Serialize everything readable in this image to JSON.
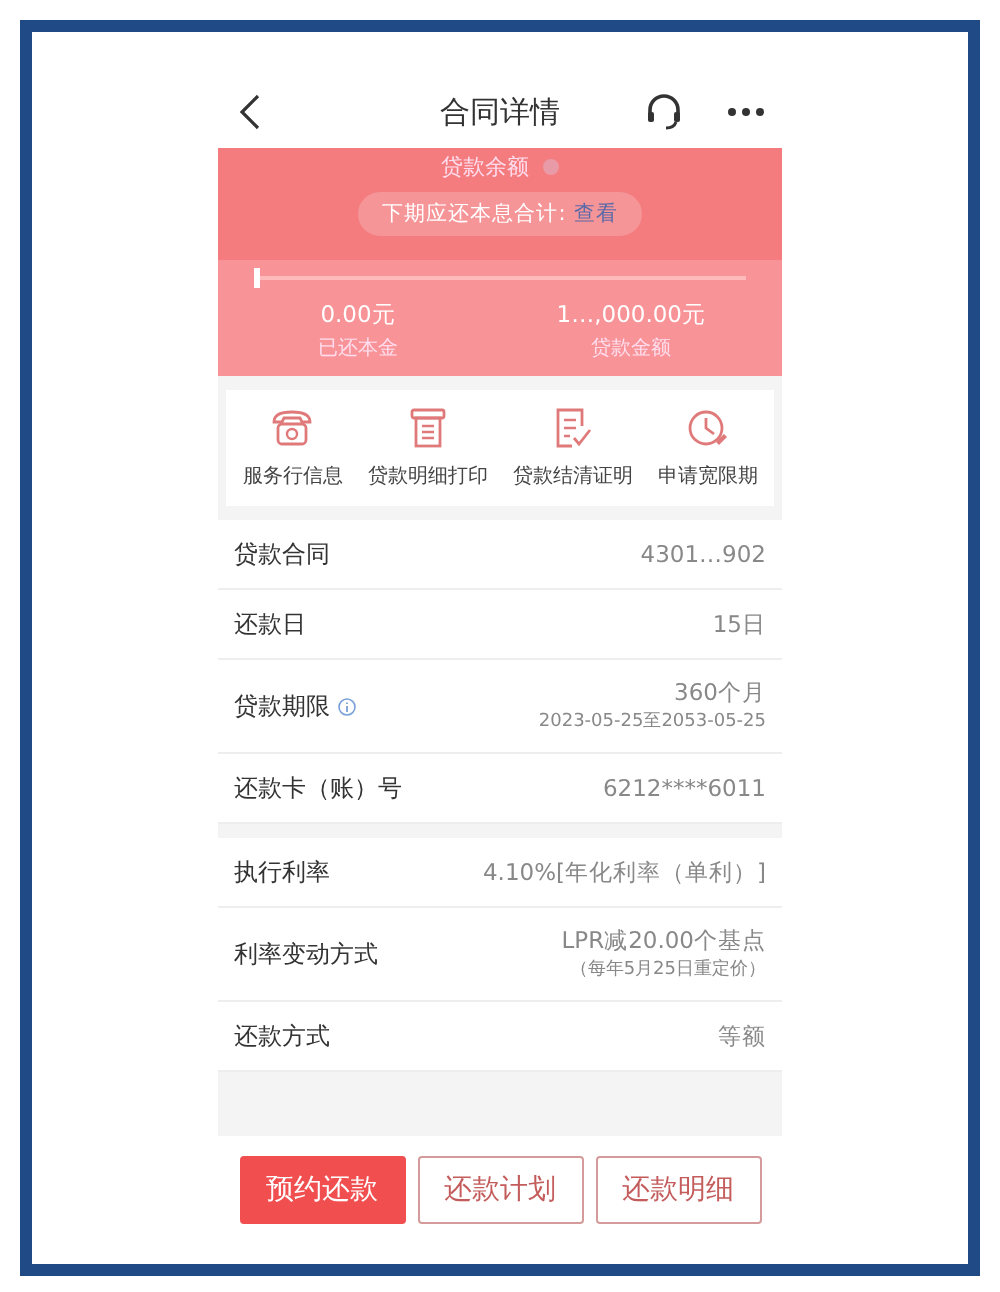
{
  "header": {
    "title": "合同详情"
  },
  "summary": {
    "balance_label": "贷款余额",
    "next_payment": {
      "label": "下期应还本息合计:",
      "link": "查看"
    },
    "progress": {
      "level": 0
    },
    "repaid": {
      "value": "0.00元",
      "label": "已还本金"
    },
    "amount": {
      "value": "1…,000.00元",
      "label": "贷款金额"
    }
  },
  "shortcuts": [
    {
      "label": "服务行信息",
      "kind": "phone"
    },
    {
      "label": "贷款明细打印",
      "kind": "receipt"
    },
    {
      "label": "贷款结清证明",
      "kind": "certificate"
    },
    {
      "label": "申请宽限期",
      "kind": "clock"
    }
  ],
  "groups": [
    [
      {
        "label": "贷款合同",
        "value": "4301…902",
        "info": false
      },
      {
        "label": "还款日",
        "value": "15日",
        "info": false
      },
      {
        "label": "贷款期限",
        "value": "360个月",
        "sub": "2023-05-25至2053-05-25",
        "info": true
      },
      {
        "label": "还款卡（账）号",
        "value": "6212****6011",
        "info": false
      }
    ],
    [
      {
        "label": "执行利率",
        "value": "4.10%[年化利率（单利）]",
        "info": false
      },
      {
        "label": "利率变动方式",
        "value": "LPR减20.00个基点",
        "sub": "（每年5月25日重定价）",
        "info": false
      },
      {
        "label": "还款方式",
        "value": "等额",
        "info": false
      }
    ]
  ],
  "buttons": [
    {
      "label": "预约还款",
      "primary": true
    },
    {
      "label": "还款计划",
      "primary": false
    },
    {
      "label": "还款明细",
      "primary": false
    }
  ]
}
